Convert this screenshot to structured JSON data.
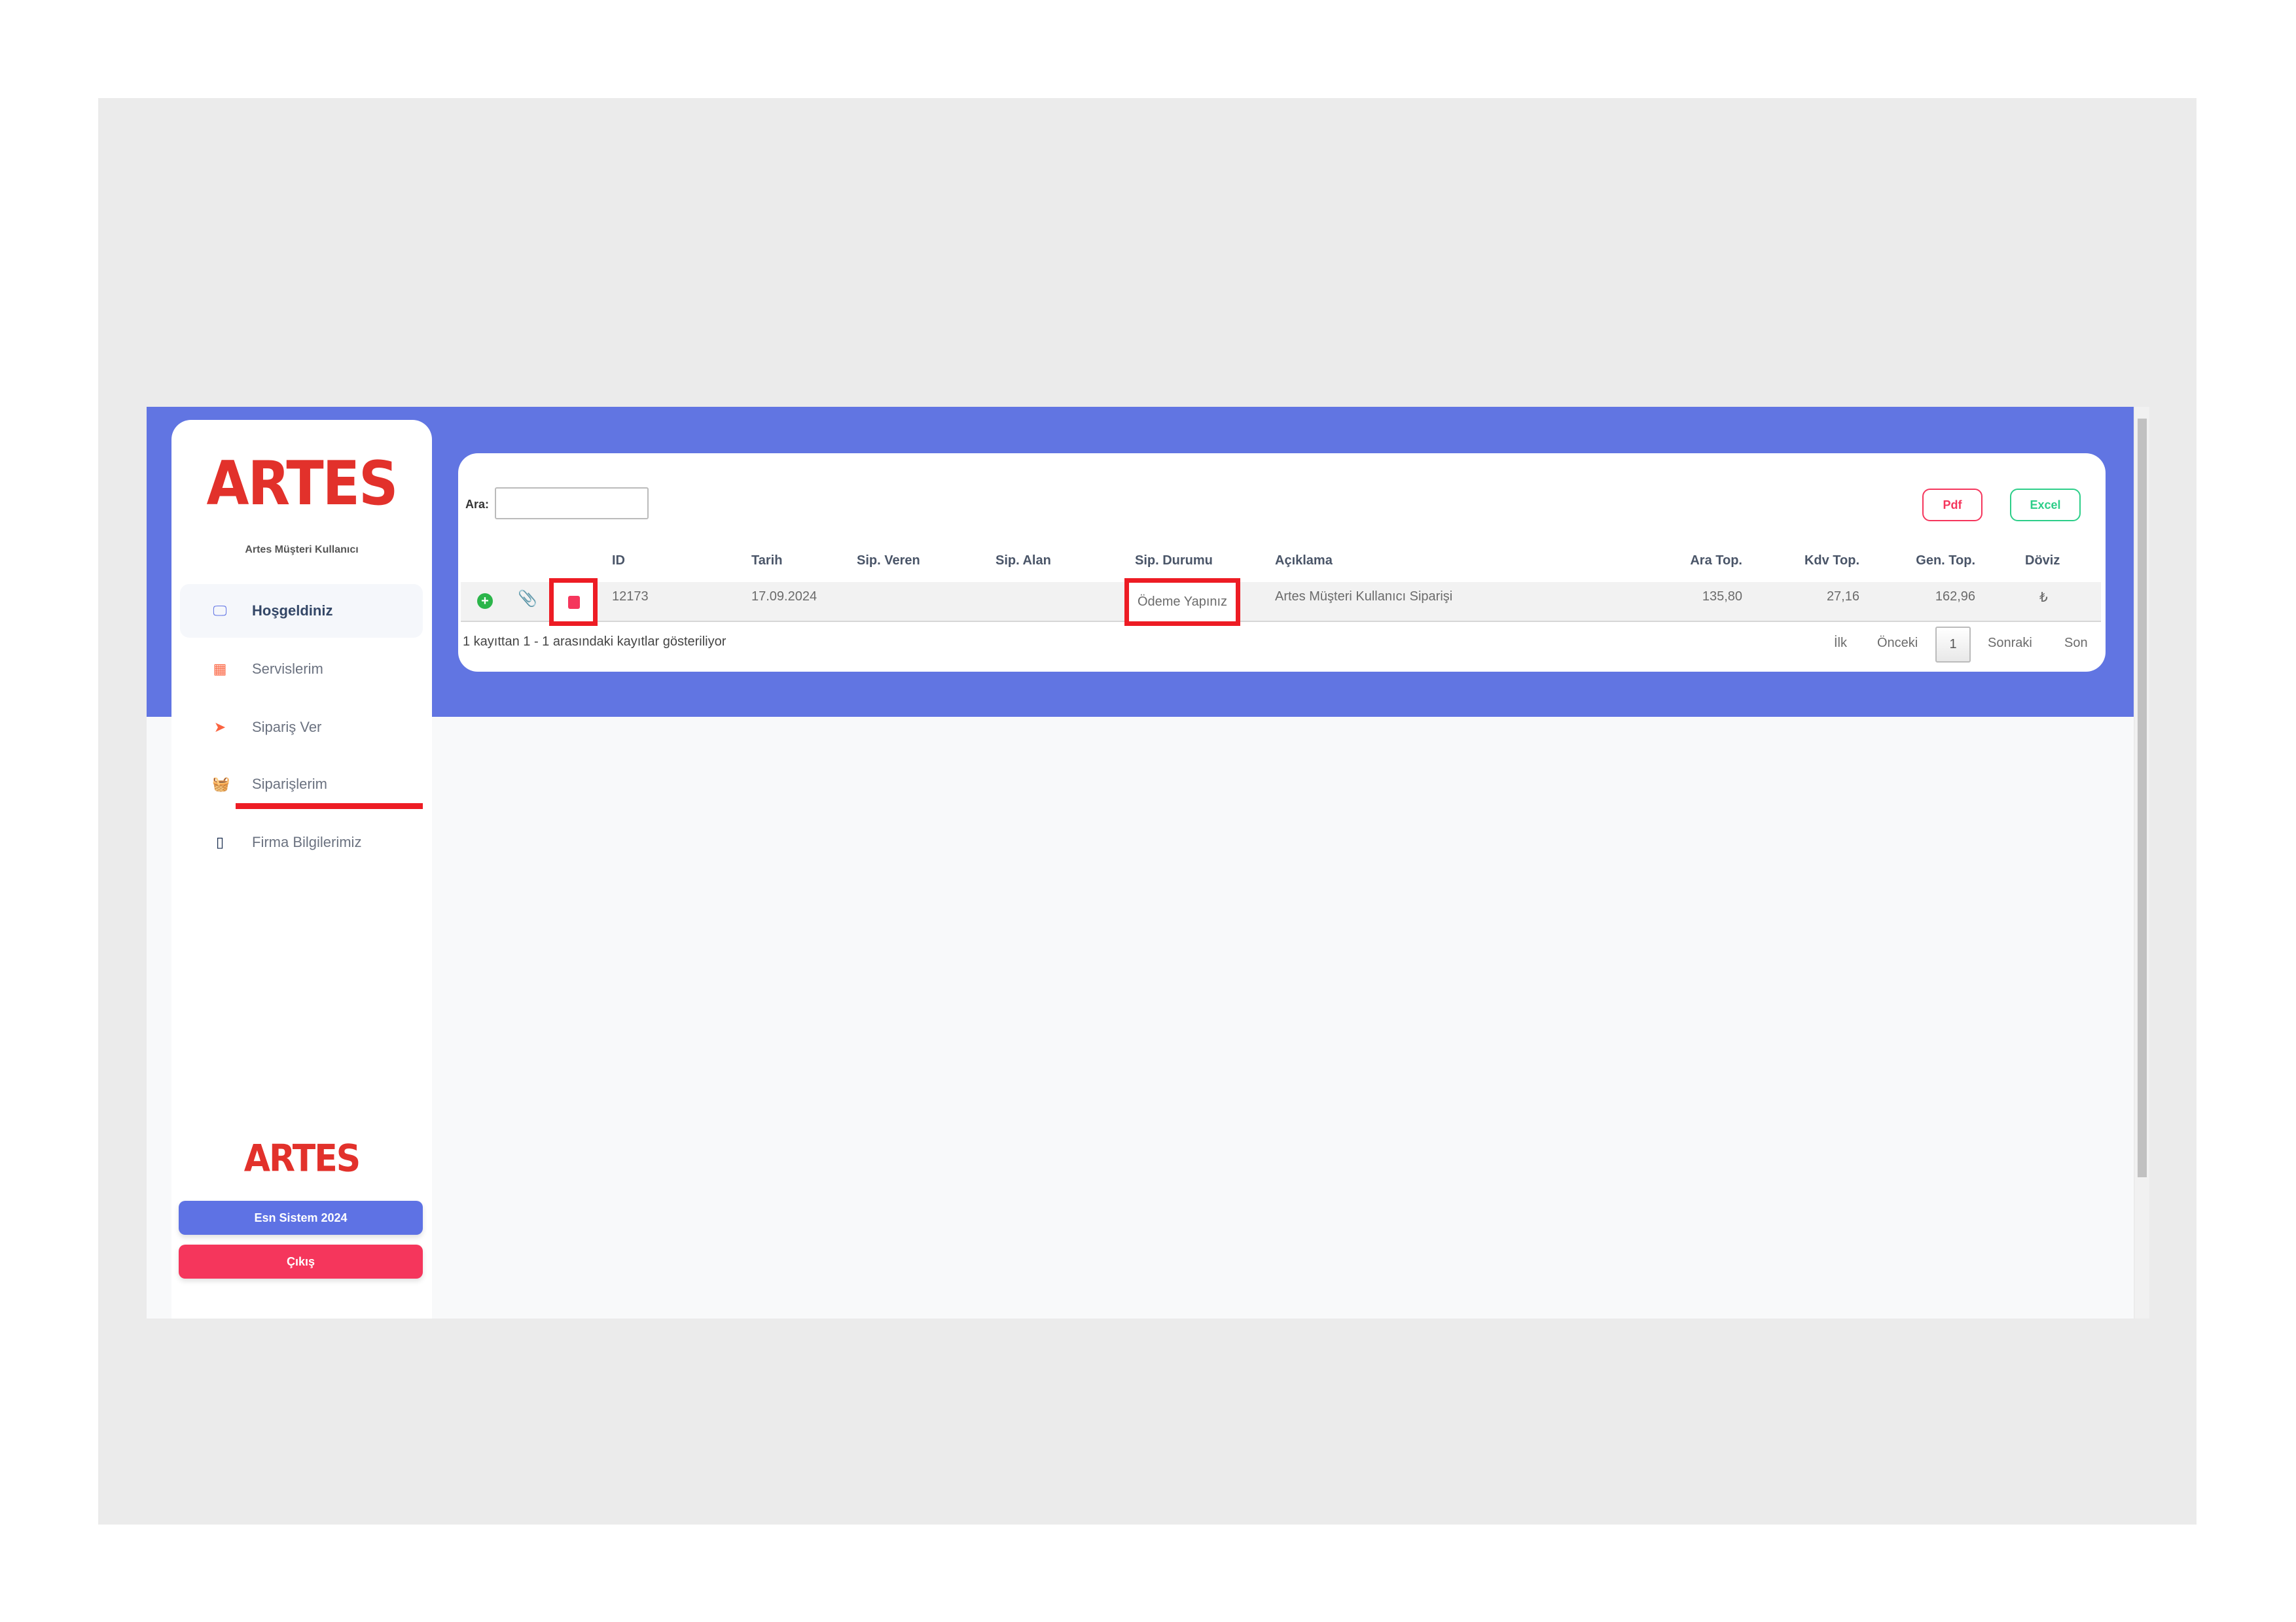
{
  "sidebar": {
    "logo": "ARTES",
    "user": "Artes Müşteri Kullanıcı",
    "items": [
      {
        "label": "Hoşgeldiniz",
        "icon": "monitor-icon",
        "active": true
      },
      {
        "label": "Servislerim",
        "icon": "calendar-icon"
      },
      {
        "label": "Sipariş Ver",
        "icon": "paper-plane-icon"
      },
      {
        "label": "Siparişlerim",
        "icon": "basket-icon",
        "highlighted": true
      },
      {
        "label": "Firma Bilgilerimiz",
        "icon": "tablet-icon"
      }
    ],
    "footer_logo": "ARTES",
    "system_button": "Esn Sistem 2024",
    "logout_button": "Çıkış"
  },
  "toolbar": {
    "search_label": "Ara:",
    "search_value": "",
    "pdf": "Pdf",
    "excel": "Excel"
  },
  "table": {
    "headers": [
      "ID",
      "Tarih",
      "Sip. Veren",
      "Sip. Alan",
      "Sip. Durumu",
      "Açıklama",
      "Ara Top.",
      "Kdv Top.",
      "Gen. Top.",
      "Döviz"
    ],
    "rows": [
      {
        "id": "12173",
        "tarih": "17.09.2024",
        "sip_veren": "",
        "sip_alan": "",
        "durum": "Ödeme Yapınız",
        "aciklama": "Artes Müşteri Kullanıcı Siparişi",
        "ara_top": "135,80",
        "kdv_top": "27,16",
        "gen_top": "162,96",
        "doviz": "₺"
      }
    ],
    "info": "1 kayıttan 1 - 1 arasındaki kayıtlar gösteriliyor"
  },
  "pagination": {
    "first": "İlk",
    "prev": "Önceki",
    "current": "1",
    "next": "Sonraki",
    "last": "Son"
  },
  "colors": {
    "brand_blue": "#6175e2",
    "brand_red": "#e2312b",
    "highlight": "#ed1c24",
    "logout": "#f5365c",
    "excel": "#2dce89"
  }
}
